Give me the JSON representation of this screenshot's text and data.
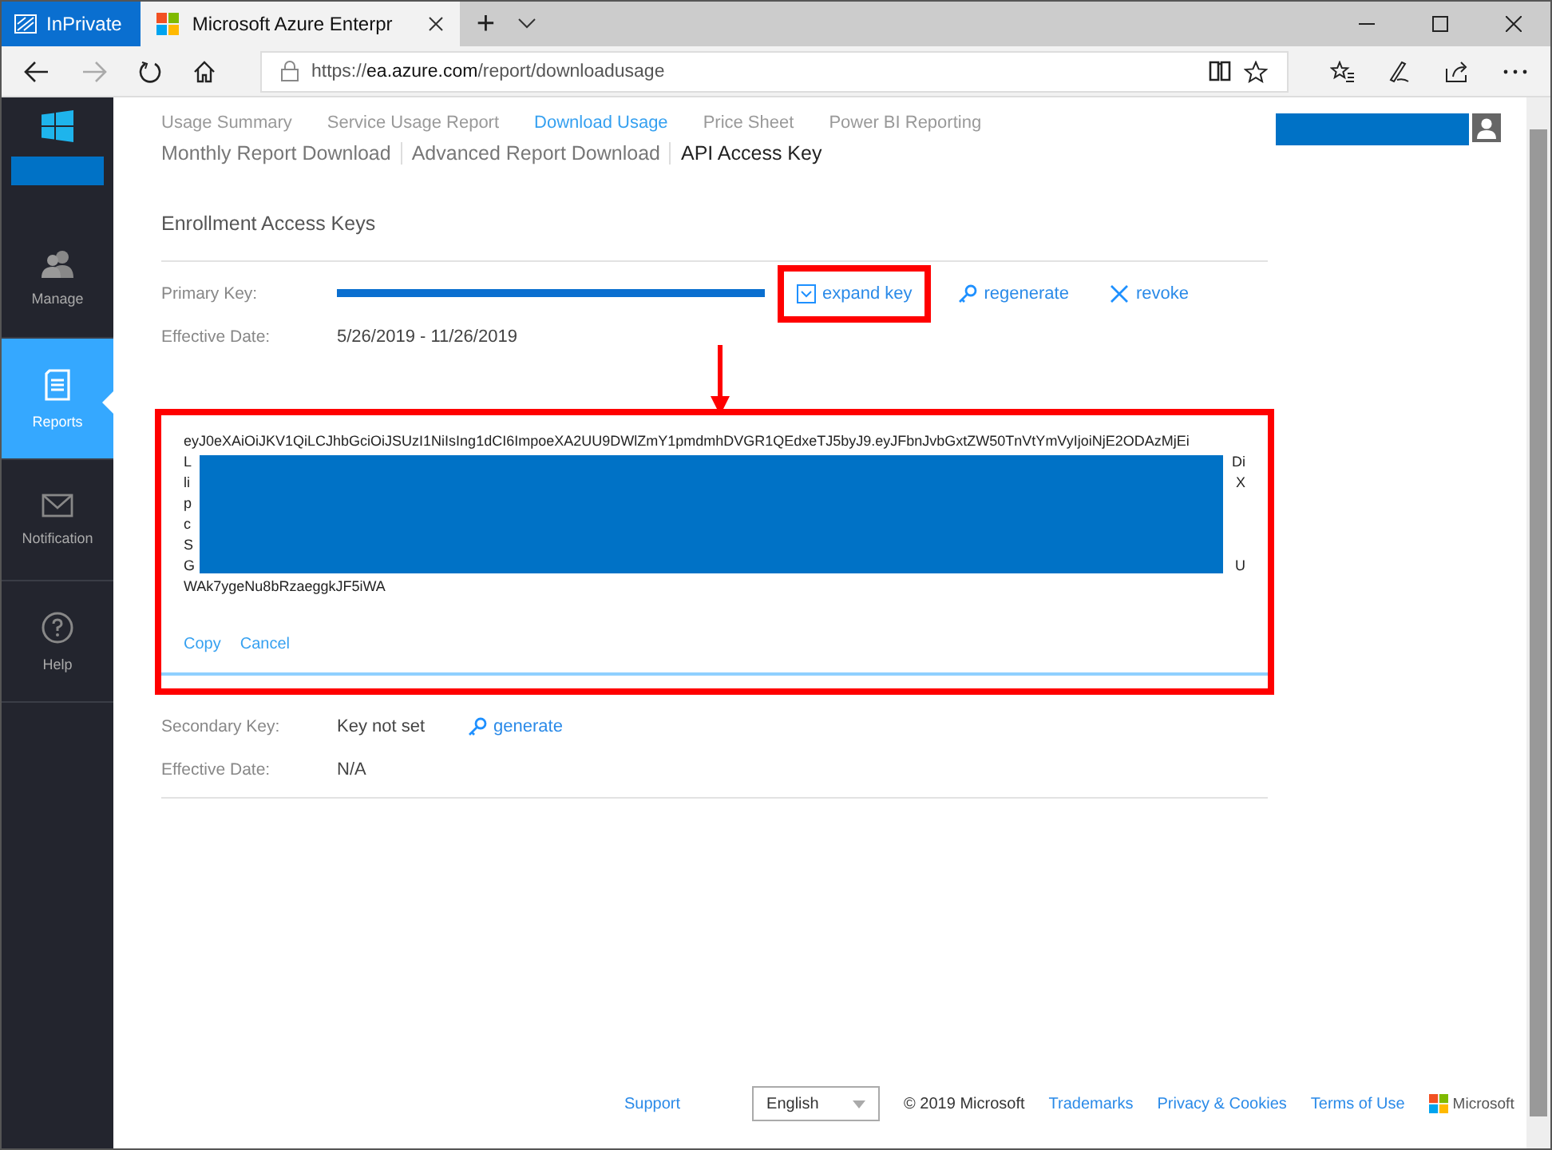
{
  "browser": {
    "private_label": "InPrivate",
    "tab_title": "Microsoft Azure Enterpr",
    "new_tab": "+",
    "url_prefix": "https://",
    "url_host": "ea.azure.com",
    "url_path": "/report/downloadusage"
  },
  "sidebar": {
    "items": [
      {
        "label": "Manage",
        "kind": "people",
        "selected": false
      },
      {
        "label": "Reports",
        "kind": "report",
        "selected": true
      },
      {
        "label": "Notification",
        "kind": "mail",
        "selected": false
      },
      {
        "label": "Help",
        "kind": "help",
        "selected": false
      }
    ]
  },
  "nav": [
    {
      "label": "Usage Summary",
      "selected": false
    },
    {
      "label": "Service Usage Report",
      "selected": false
    },
    {
      "label": "Download Usage",
      "selected": true
    },
    {
      "label": "Price Sheet",
      "selected": false
    },
    {
      "label": "Power BI Reporting",
      "selected": false
    }
  ],
  "subnav": [
    {
      "label": "Monthly Report Download",
      "selected": false
    },
    {
      "label": "Advanced Report Download",
      "selected": false
    },
    {
      "label": "API Access Key",
      "selected": true
    }
  ],
  "section_title": "Enrollment Access Keys",
  "primary": {
    "label": "Primary Key:",
    "actions": [
      {
        "label": "expand key",
        "kind": "expand",
        "highlighted": true
      },
      {
        "label": "regenerate",
        "kind": "key",
        "highlighted": false
      },
      {
        "label": "revoke",
        "kind": "close",
        "highlighted": false
      }
    ],
    "date_label": "Effective Date:",
    "date": "5/26/2019  -  11/26/2019"
  },
  "key_panel": {
    "first_line": "eyJ0eXAiOiJKV1QiLCJhbGciOiJSUzI1NiIsIng1dCI6ImpoeXA2UU9DWlZmY1pmdmhDVGR1QEdxeTJ5byJ9.eyJFbnJvbGxtZW50TnVtYmVyIjoiNjE2ODAzMjEi",
    "edge_lines": [
      {
        "left": "L",
        "right": "Di"
      },
      {
        "left": "li",
        "right": "X"
      },
      {
        "left": "p"
      },
      {
        "left": "c"
      },
      {
        "left": "S"
      },
      {
        "left": "G",
        "right": "U"
      }
    ],
    "last_line": "WAk7ygeNu8bRzaeggkJF5iWA",
    "buttons": [
      "Copy",
      "Cancel"
    ]
  },
  "secondary": {
    "label": "Secondary Key:",
    "value": "Key not set",
    "action": "generate",
    "date_label": "Effective Date:",
    "date": "N/A"
  },
  "footer": {
    "support": "Support",
    "language": "English",
    "copyright": "© 2019 Microsoft",
    "links": [
      "Trademarks",
      "Privacy & Cookies",
      "Terms of Use"
    ],
    "brand": "Microsoft"
  }
}
